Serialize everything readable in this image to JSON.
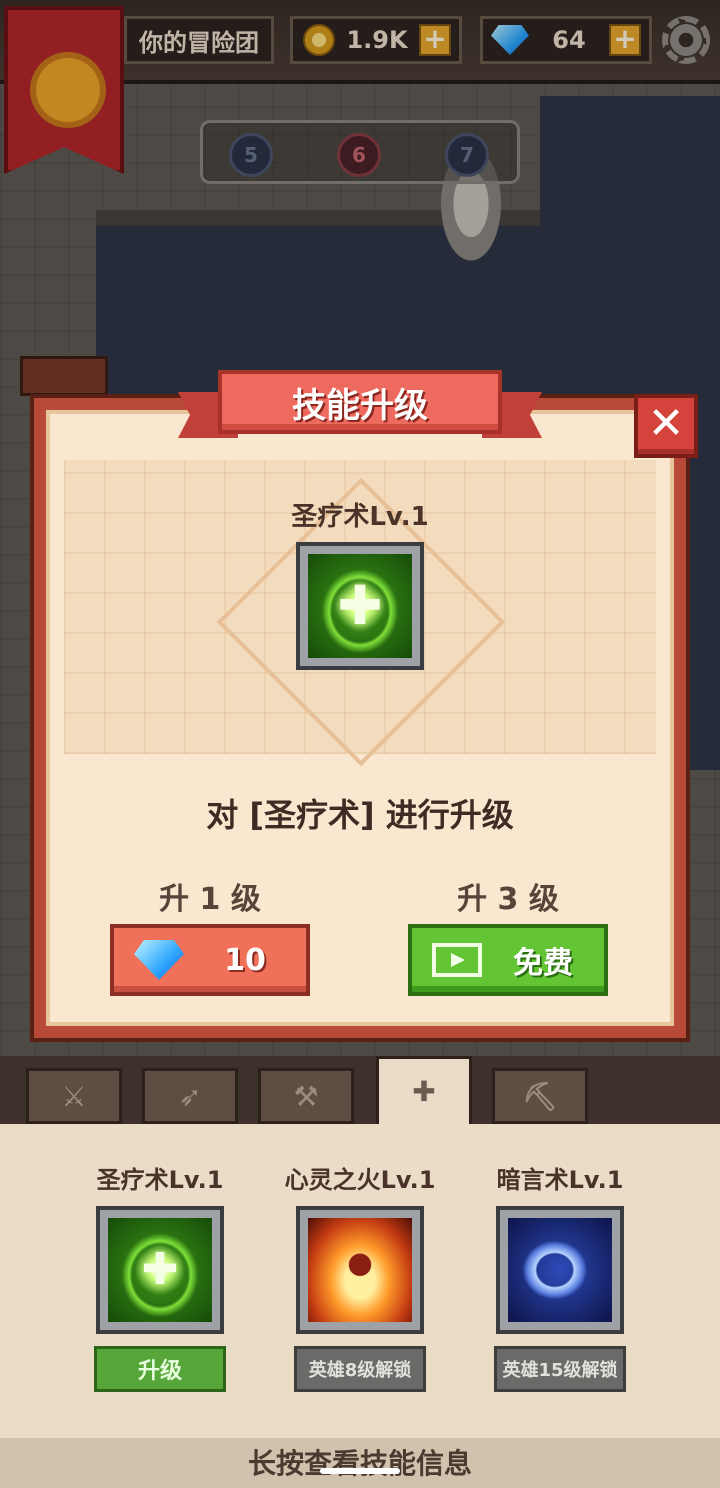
{
  "top_bar": {
    "team_label": "你的冒险团",
    "gold": "1.9K",
    "gems": "64",
    "plus": "+"
  },
  "floor_selector": {
    "floors": [
      "5",
      "6",
      "7"
    ],
    "current": "6"
  },
  "dialog": {
    "title": "技能升级",
    "close": "✕",
    "skill_title": "圣疗术Lv.1",
    "skill_icon": "heal-cross-icon",
    "description": "对 [圣疗术] 进行升级",
    "options": [
      {
        "label": "升 1 级",
        "cost_icon": "gem-icon",
        "value": "10"
      },
      {
        "label": "升 3 级",
        "cost_icon": "video-icon",
        "value": "免费"
      }
    ]
  },
  "tabs": [
    {
      "icon": "sword-icon",
      "glyph": "⚔"
    },
    {
      "icon": "bow-icon",
      "glyph": "➶"
    },
    {
      "icon": "wand-icon",
      "glyph": "⚒"
    },
    {
      "icon": "cross-icon",
      "glyph": "✚"
    },
    {
      "icon": "axe-icon",
      "glyph": "⛏"
    }
  ],
  "skills": [
    {
      "name": "圣疗术Lv.1",
      "icon": "heal-icon",
      "action": "升级",
      "state": "upgradable"
    },
    {
      "name": "心灵之火Lv.1",
      "icon": "inner-fire-icon",
      "action": "英雄8级解锁",
      "state": "locked"
    },
    {
      "name": "暗言术Lv.1",
      "icon": "shadow-word-icon",
      "action": "英雄15级解锁",
      "state": "locked"
    }
  ],
  "footer_hint": "长按查看技能信息",
  "colors": {
    "accent_red": "#ef6a5e",
    "accent_green": "#63c534",
    "parchment": "#f9e7cf"
  }
}
